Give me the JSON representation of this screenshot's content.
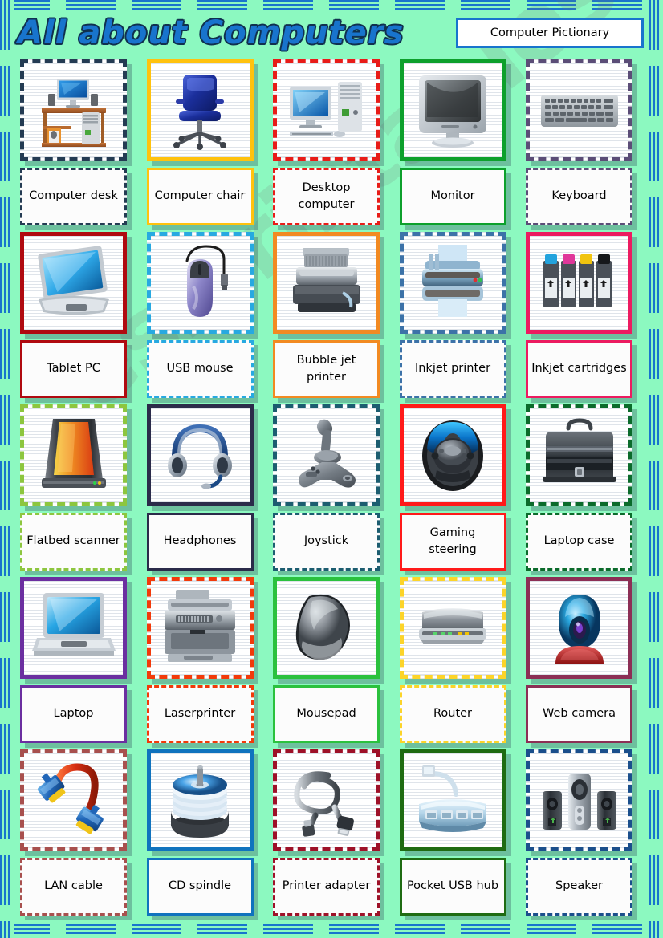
{
  "header": {
    "title": "All about Computers",
    "subtitle": "Computer Pictionary"
  },
  "watermark": "eslprintables.com",
  "colors": {
    "page_background": "#8CF9C0",
    "frame": "#1874CD",
    "title_fill": "#1874CD",
    "title_outline": "#10314F",
    "card_background": "#FFFFFF"
  },
  "cards": [
    {
      "label": "Computer desk",
      "icon": "computer-desk-icon",
      "border_color": "#243B53",
      "border_style": "dashed"
    },
    {
      "label": "Computer chair",
      "icon": "office-chair-icon",
      "border_color": "#FFC20E",
      "border_style": "solid"
    },
    {
      "label": "Desktop computer",
      "icon": "desktop-computer-icon",
      "border_color": "#E81C18",
      "border_style": "dashed"
    },
    {
      "label": "Monitor",
      "icon": "crt-monitor-icon",
      "border_color": "#0DA02C",
      "border_style": "solid"
    },
    {
      "label": "Keyboard",
      "icon": "keyboard-icon",
      "border_color": "#5B4D77",
      "border_style": "dashed"
    },
    {
      "label": "Tablet PC",
      "icon": "tablet-pc-icon",
      "border_color": "#B00A10",
      "border_style": "solid"
    },
    {
      "label": "USB mouse",
      "icon": "usb-mouse-icon",
      "border_color": "#27A9E1",
      "border_style": "dashed"
    },
    {
      "label": "Bubble jet printer",
      "icon": "bubble-jet-printer-icon",
      "border_color": "#F28A22",
      "border_style": "solid"
    },
    {
      "label": "Inkjet printer",
      "icon": "inkjet-printer-icon",
      "border_color": "#3C72A8",
      "border_style": "dashed"
    },
    {
      "label": "Inkjet cartridges",
      "icon": "inkjet-cartridges-icon",
      "border_color": "#EC1B60",
      "border_style": "solid"
    },
    {
      "label": "Flatbed scanner",
      "icon": "flatbed-scanner-icon",
      "border_color": "#8DC63F",
      "border_style": "dashed"
    },
    {
      "label": "Headphones",
      "icon": "headphones-icon",
      "border_color": "#2B2B4A",
      "border_style": "solid"
    },
    {
      "label": "Joystick",
      "icon": "joystick-icon",
      "border_color": "#1C5D70",
      "border_style": "dashed"
    },
    {
      "label": "Gaming steering",
      "icon": "steering-wheel-icon",
      "border_color": "#FF1A1A",
      "border_style": "solid"
    },
    {
      "label": "Laptop case",
      "icon": "laptop-case-icon",
      "border_color": "#0B6B2B",
      "border_style": "dashed"
    },
    {
      "label": "Laptop",
      "icon": "laptop-icon",
      "border_color": "#6B2FA0",
      "border_style": "solid"
    },
    {
      "label": "Laserprinter",
      "icon": "laser-printer-icon",
      "border_color": "#F23A0A",
      "border_style": "dashed"
    },
    {
      "label": "Mousepad",
      "icon": "mousepad-icon",
      "border_color": "#2BC13E",
      "border_style": "solid"
    },
    {
      "label": "Router",
      "icon": "router-icon",
      "border_color": "#FCD429",
      "border_style": "dashed"
    },
    {
      "label": "Web camera",
      "icon": "web-camera-icon",
      "border_color": "#8C2F55",
      "border_style": "solid"
    },
    {
      "label": "LAN cable",
      "icon": "lan-cable-icon",
      "border_color": "#A8504E",
      "border_style": "dashed"
    },
    {
      "label": "CD spindle",
      "icon": "cd-spindle-icon",
      "border_color": "#1073BE",
      "border_style": "solid"
    },
    {
      "label": "Printer adapter",
      "icon": "printer-adapter-icon",
      "border_color": "#9E1128",
      "border_style": "dashed"
    },
    {
      "label": "Pocket USB hub",
      "icon": "usb-hub-icon",
      "border_color": "#1F6B12",
      "border_style": "solid"
    },
    {
      "label": "Speaker",
      "icon": "speaker-icon",
      "border_color": "#1B4F8C",
      "border_style": "dashed"
    }
  ]
}
